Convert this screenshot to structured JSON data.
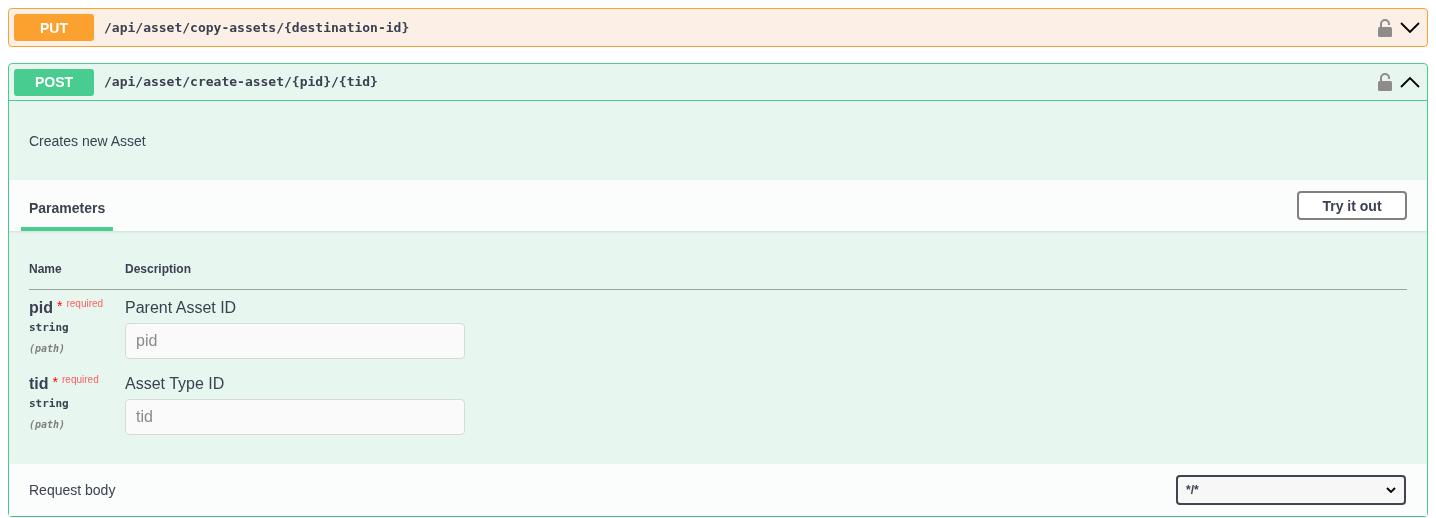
{
  "operations": [
    {
      "method": "PUT",
      "path": "/api/asset/copy-assets/{destination-id}",
      "expanded": false
    },
    {
      "method": "POST",
      "path": "/api/asset/create-asset/{pid}/{tid}",
      "expanded": true,
      "description": "Creates new Asset",
      "tabs": [
        {
          "label": "Parameters",
          "selected": true
        }
      ],
      "try_button": "Try it out",
      "columns": [
        "Name",
        "Description"
      ],
      "parameters": [
        {
          "name": "pid",
          "required_mark": "*",
          "required": "required",
          "type": "string",
          "location": "(path)",
          "description": "Parent Asset ID",
          "placeholder": "pid"
        },
        {
          "name": "tid",
          "required_mark": "*",
          "required": "required",
          "type": "string",
          "location": "(path)",
          "description": "Asset Type ID",
          "placeholder": "tid"
        }
      ],
      "request_body": {
        "label": "Request body",
        "content_type": "*/*"
      }
    }
  ]
}
